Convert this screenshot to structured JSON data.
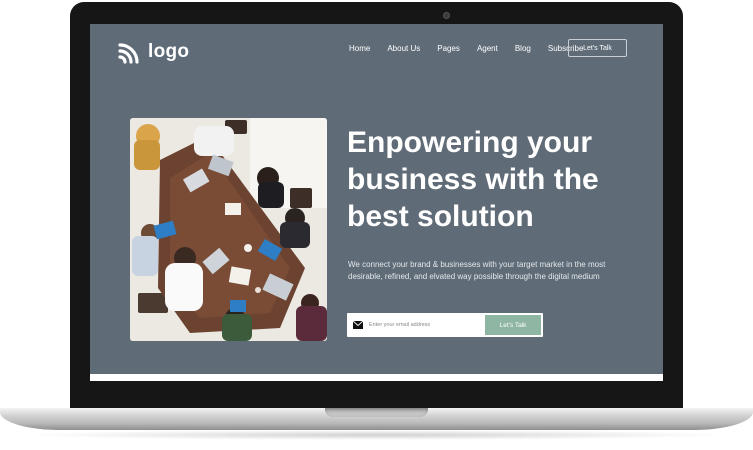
{
  "header": {
    "logo_text": "logo",
    "nav": [
      "Home",
      "About Us",
      "Pages",
      "Agent",
      "Blog",
      "Subscribe"
    ],
    "cta_label": "Let's Talk"
  },
  "hero": {
    "headline": "Enpowering your business with the best solution",
    "subtext": "We connect your brand & businesses with your target market in the most desirable, refined, and elvated way possible through the digital medium",
    "email_placeholder": "Enter your email address",
    "submit_label": "Let's Talk",
    "icon": "mail-icon",
    "accent_color": "#8fb5a3",
    "background_color": "#5f6b77"
  }
}
